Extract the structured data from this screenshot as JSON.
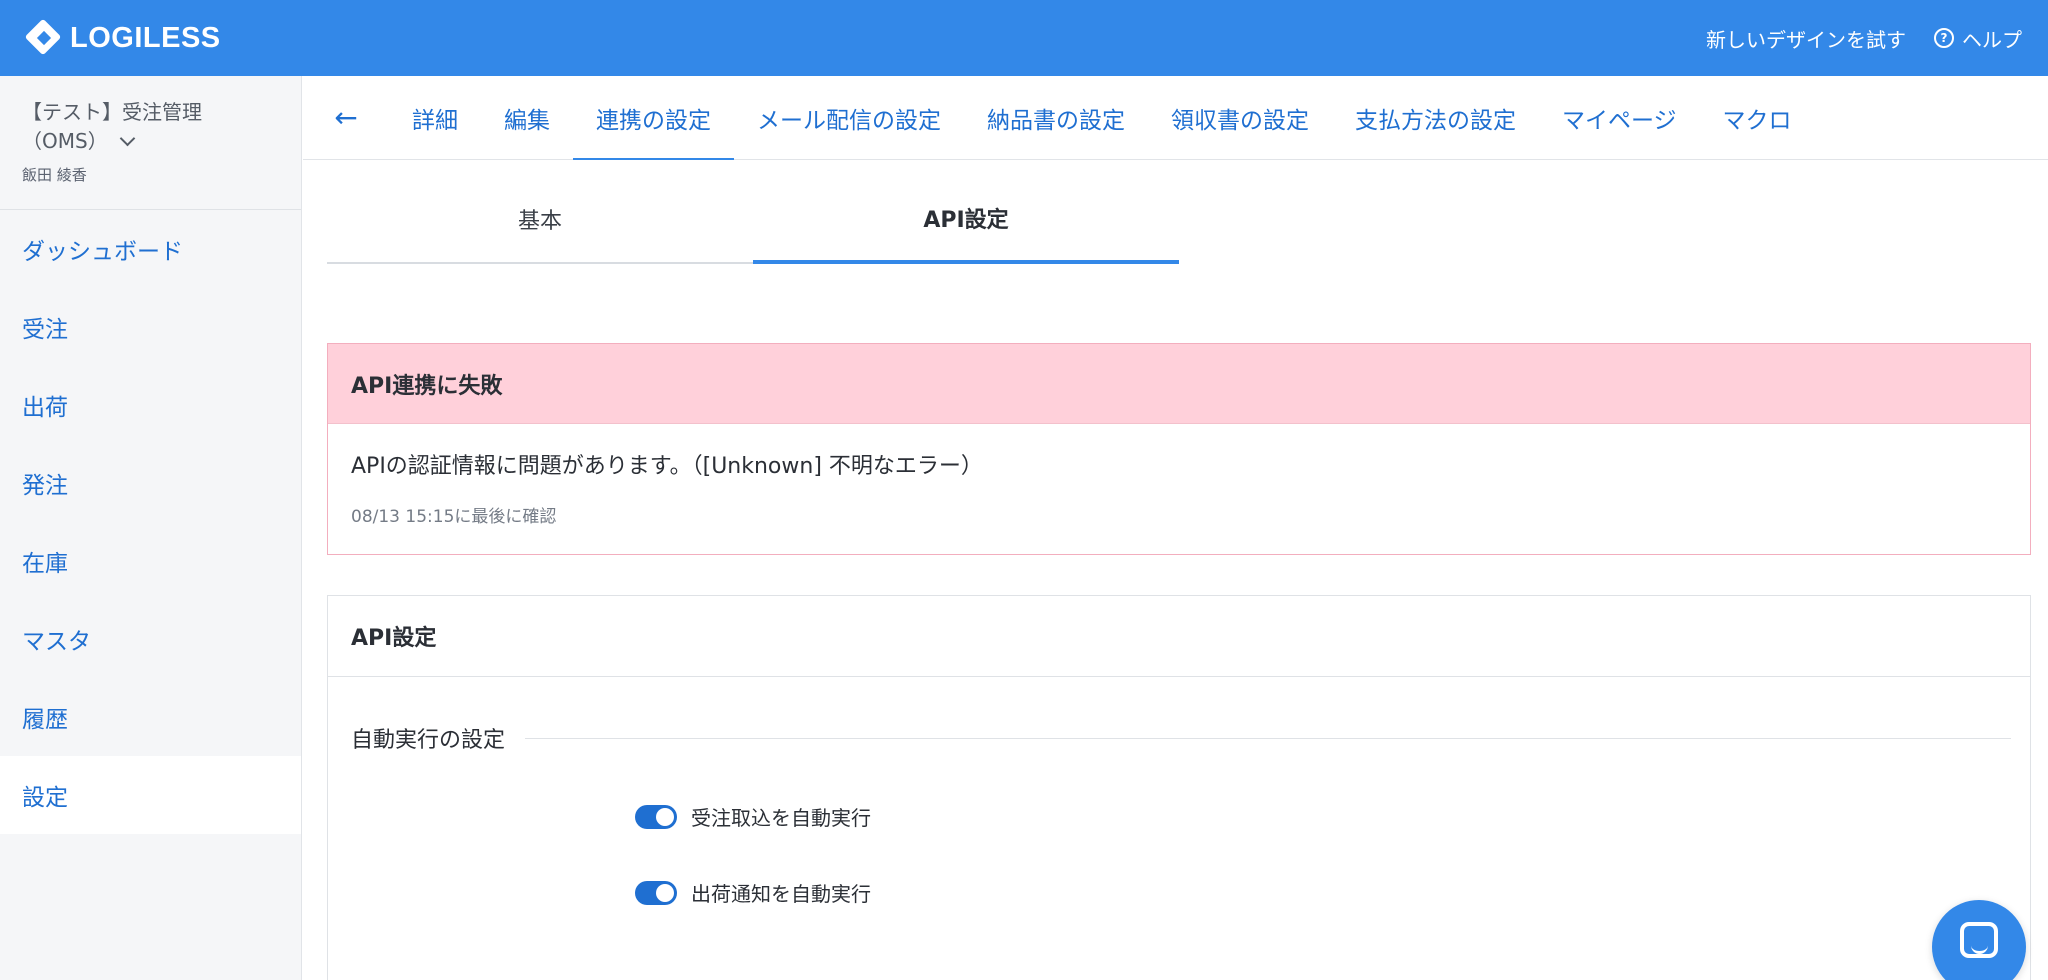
{
  "header": {
    "logo_text": "LOGILESS",
    "try_new_design": "新しいデザインを試す",
    "help_label": "ヘルプ",
    "help_icon": "?"
  },
  "sidebar": {
    "org_name_line1": "【テスト】受注管理",
    "org_name_line2": "（OMS）",
    "user_name": "飯田 綾香",
    "items": [
      {
        "label": "ダッシュボード"
      },
      {
        "label": "受注"
      },
      {
        "label": "出荷"
      },
      {
        "label": "発注"
      },
      {
        "label": "在庫"
      },
      {
        "label": "マスタ"
      },
      {
        "label": "履歴"
      },
      {
        "label": "設定"
      }
    ],
    "active_index": 7
  },
  "topnav": {
    "back_icon": "←",
    "tabs": [
      {
        "label": "詳細"
      },
      {
        "label": "編集"
      },
      {
        "label": "連携の設定"
      },
      {
        "label": "メール配信の設定"
      },
      {
        "label": "納品書の設定"
      },
      {
        "label": "領収書の設定"
      },
      {
        "label": "支払方法の設定"
      },
      {
        "label": "マイページ"
      },
      {
        "label": "マクロ"
      }
    ],
    "active_index": 2
  },
  "subtabs": {
    "basic": "基本",
    "api": "API設定",
    "active": "api"
  },
  "alert": {
    "title": "API連携に失敗",
    "message": "APIの認証情報に問題があります。（[Unknown] 不明なエラー）",
    "checked_at": "08/13 15:15に最後に確認"
  },
  "api_card": {
    "title": "API設定",
    "section_title": "自動実行の設定",
    "toggles": [
      {
        "label": "受注取込を自動実行",
        "on": true
      },
      {
        "label": "出荷通知を自動実行",
        "on": true
      }
    ]
  },
  "colors": {
    "header_bg": "#3388e8",
    "link": "#1f6fd1",
    "alert_bg": "#ffd0da",
    "alert_border": "#f3aebe"
  }
}
